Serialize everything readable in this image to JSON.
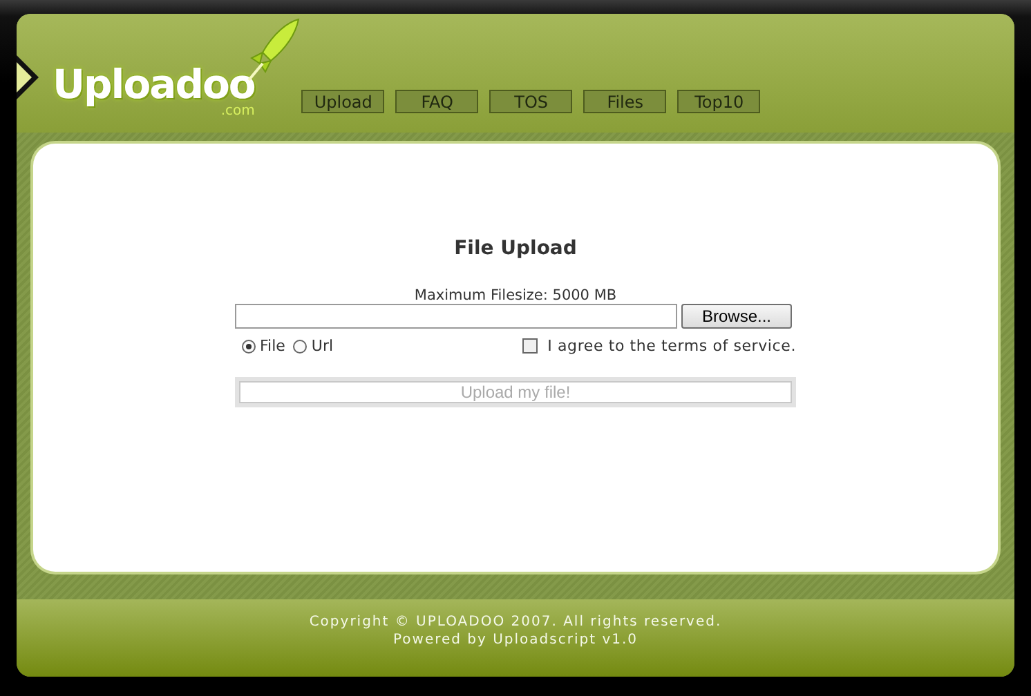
{
  "logo": {
    "name": "Uploadoo",
    "suffix": ".com"
  },
  "nav": [
    {
      "label": "Upload"
    },
    {
      "label": "FAQ"
    },
    {
      "label": "TOS"
    },
    {
      "label": "Files"
    },
    {
      "label": "Top10"
    }
  ],
  "upload": {
    "title": "File Upload",
    "max_size": "Maximum Filesize: 5000 MB",
    "browse": "Browse...",
    "modes": [
      {
        "label": "File",
        "selected": true
      },
      {
        "label": "Url",
        "selected": false
      }
    ],
    "terms": {
      "label": "I agree to the terms of service.",
      "checked": false
    },
    "submit": {
      "label": "Upload my file!",
      "disabled": true
    }
  },
  "footer": [
    "Copyright © UPLOADOO 2007. All rights reserved.",
    "Powered by Uploadscript v1.0"
  ]
}
